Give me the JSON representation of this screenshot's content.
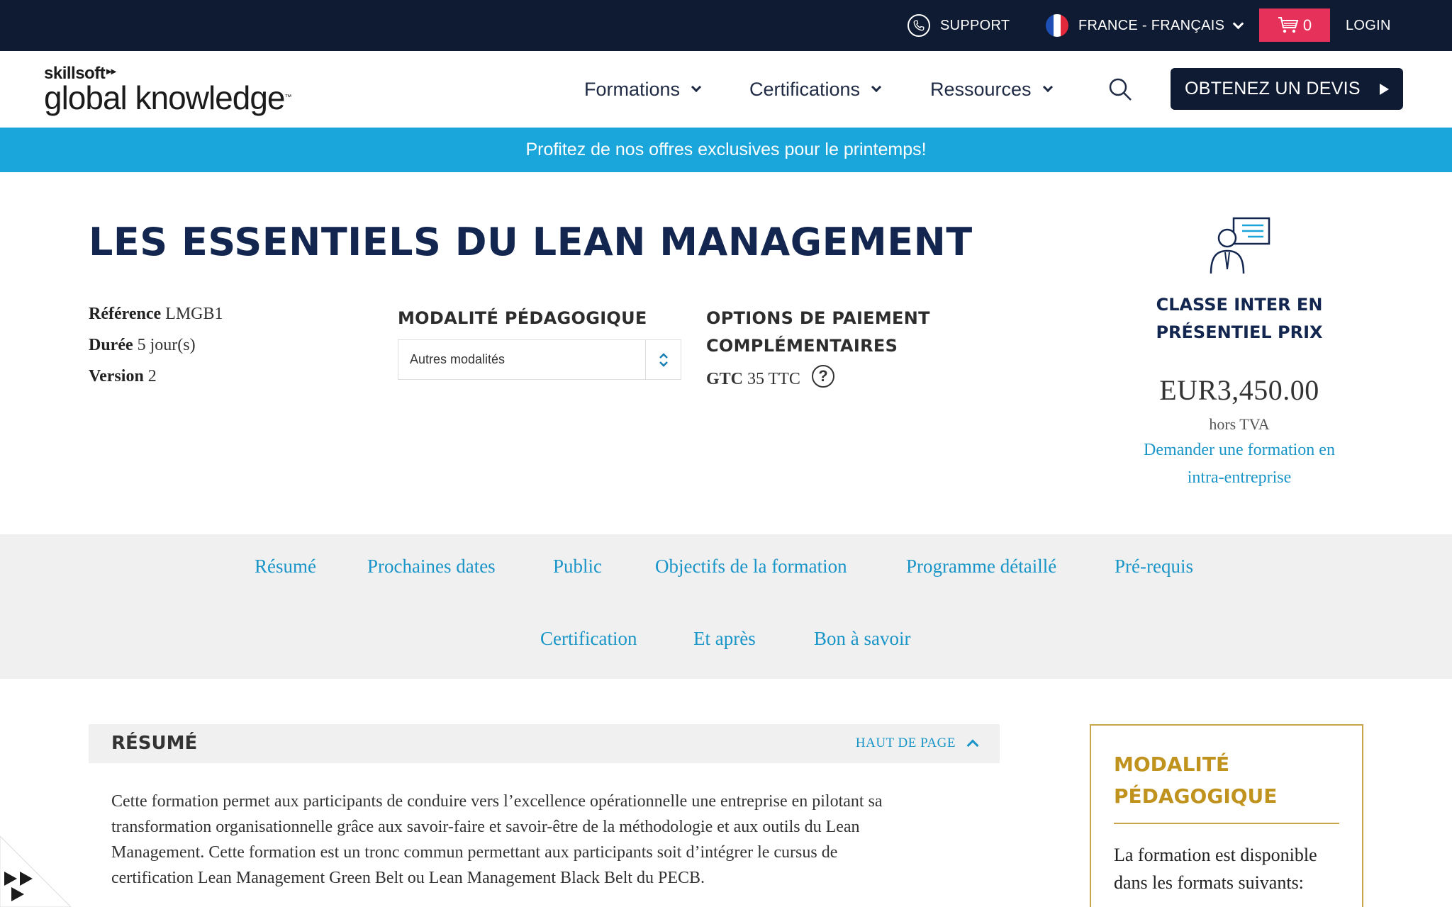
{
  "topbar": {
    "support_label": "SUPPORT",
    "language_label": "FRANCE - FRANÇAIS",
    "cart_count": "0",
    "login_label": "LOGIN"
  },
  "header": {
    "logo_small": "skillsoft",
    "logo_big": "global knowledge",
    "nav": [
      "Formations",
      "Certifications",
      "Ressources"
    ],
    "cta_label": "OBTENEZ UN DEVIS"
  },
  "promo": {
    "text": "Profitez de nos offres exclusives pour le printemps!"
  },
  "course": {
    "title": "LES ESSENTIELS DU LEAN MANAGEMENT",
    "meta": [
      {
        "label": "Référence",
        "value": "LMGB1"
      },
      {
        "label": "Durée",
        "value": "5 jour(s)"
      },
      {
        "label": "Version",
        "value": "2"
      }
    ],
    "modalite_heading": "MODALITÉ PÉDAGOGIQUE",
    "modalite_selected": "Autres modalités",
    "paiement_heading_1": "OPTIONS DE PAIEMENT",
    "paiement_heading_2": "COMPLÉMENTAIRES",
    "gtc_label": "GTC",
    "gtc_value": "35 TTC",
    "help_glyph": "?"
  },
  "pricing": {
    "title_1": "CLASSE INTER EN",
    "title_2": "PRÉSENTIEL PRIX",
    "price": "EUR3,450.00",
    "tax_note": "hors TVA",
    "intra_1": "Demander une formation en",
    "intra_2": "intra-entreprise"
  },
  "tabs": {
    "row1": [
      "Résumé",
      "Prochaines dates",
      "Public",
      "Objectifs de la formation",
      "Programme détaillé",
      "Pré-requis"
    ],
    "row2": [
      "Certification",
      "Et après",
      "Bon à savoir"
    ]
  },
  "resume": {
    "heading": "RÉSUMÉ",
    "back_to_top": "HAUT DE PAGE",
    "lines": [
      "Cette formation permet aux participants de conduire vers l’excellence opérationnelle une entreprise en pilotant sa",
      "transformation organisationnelle grâce aux savoir-faire et savoir-être de la méthodologie et aux outils du Lean",
      "Management. Cette formation est un tronc commun permettant aux participants soit d’intégrer le cursus de",
      "certification Lean Management Green Belt ou Lean Management Black Belt du PECB."
    ]
  },
  "sidebox": {
    "title_1": "MODALITÉ",
    "title_2": "PÉDAGOGIQUE",
    "text_1": "La formation est disponible",
    "text_2": "dans les formats suivants:"
  },
  "colors": {
    "navy": "#0f1b33",
    "brand_title": "#12264f",
    "promo_blue": "#1aa5db",
    "link_blue": "#1a95c8",
    "cart_pink": "#e6325a",
    "gold": "#c0921e"
  }
}
